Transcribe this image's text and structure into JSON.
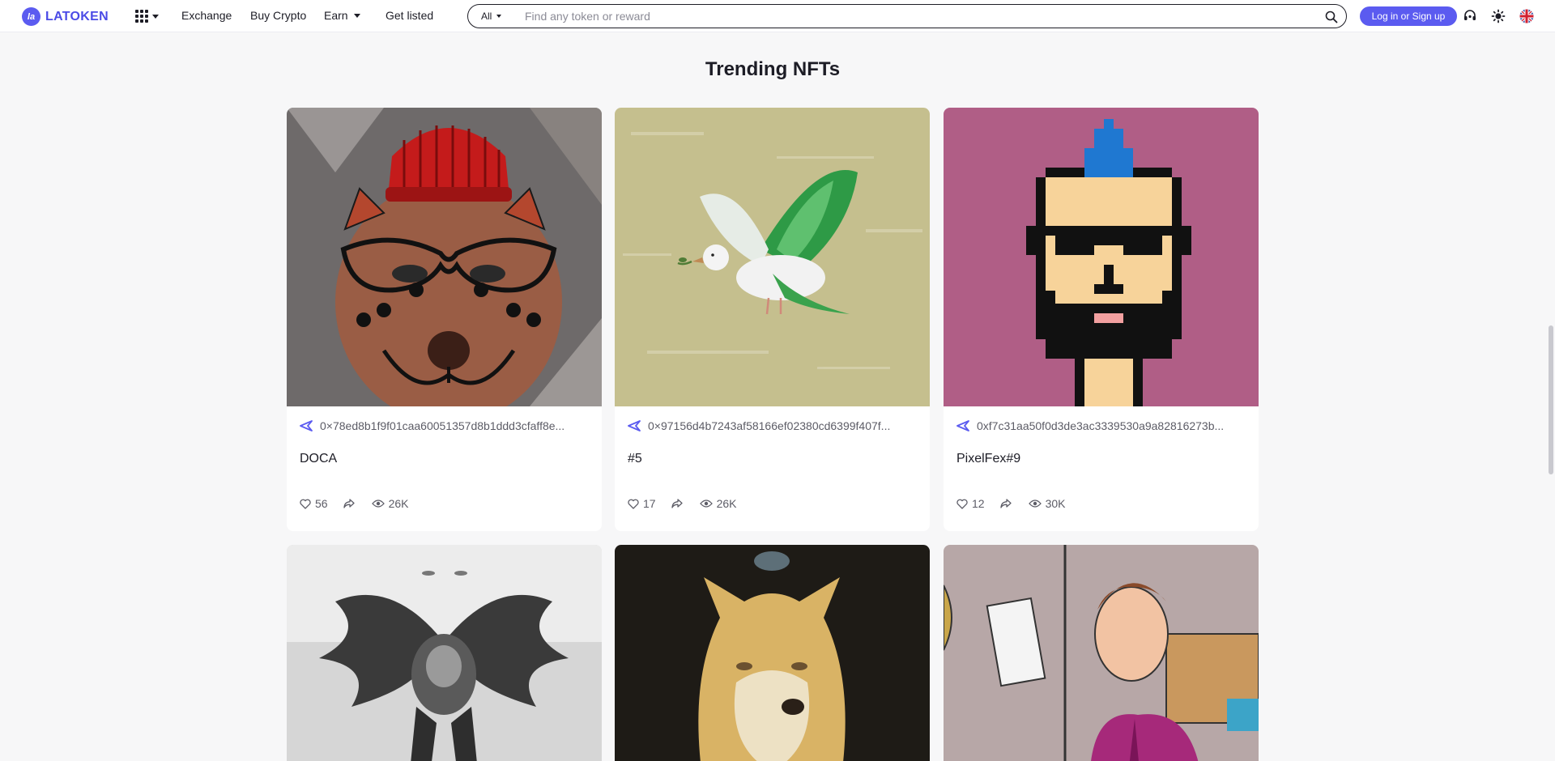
{
  "header": {
    "logo_text": "LATOKEN",
    "logo_mark": "la",
    "nav": {
      "exchange": "Exchange",
      "buy_crypto": "Buy Crypto",
      "earn": "Earn",
      "get_listed": "Get listed"
    },
    "search": {
      "category": "All",
      "placeholder": "Find any token or reward"
    },
    "login_label": "Log in or Sign up",
    "icons": [
      "apps-grid-icon",
      "search-icon",
      "support-icon",
      "theme-icon",
      "language-flag-icon"
    ]
  },
  "main": {
    "section_title": "Trending NFTs",
    "cards": [
      {
        "address": "0×78ed8b1f9f01caa60051357d8b1ddd3cfaff8e...",
        "name": "DOCA",
        "likes": "56",
        "views": "26K"
      },
      {
        "address": "0×97156d4b7243af58166ef02380cd6399f407f...",
        "name": "#5",
        "likes": "17",
        "views": "26K"
      },
      {
        "address": "0xf7c31aa50f0d3de3ac3339530a9a82816273b...",
        "name": "PixelFex#9",
        "likes": "12",
        "views": "30K"
      }
    ]
  },
  "colors": {
    "brand": "#5b5bf0",
    "text": "#1d1d26",
    "muted": "#5c5c66",
    "background": "#f7f7f8"
  }
}
